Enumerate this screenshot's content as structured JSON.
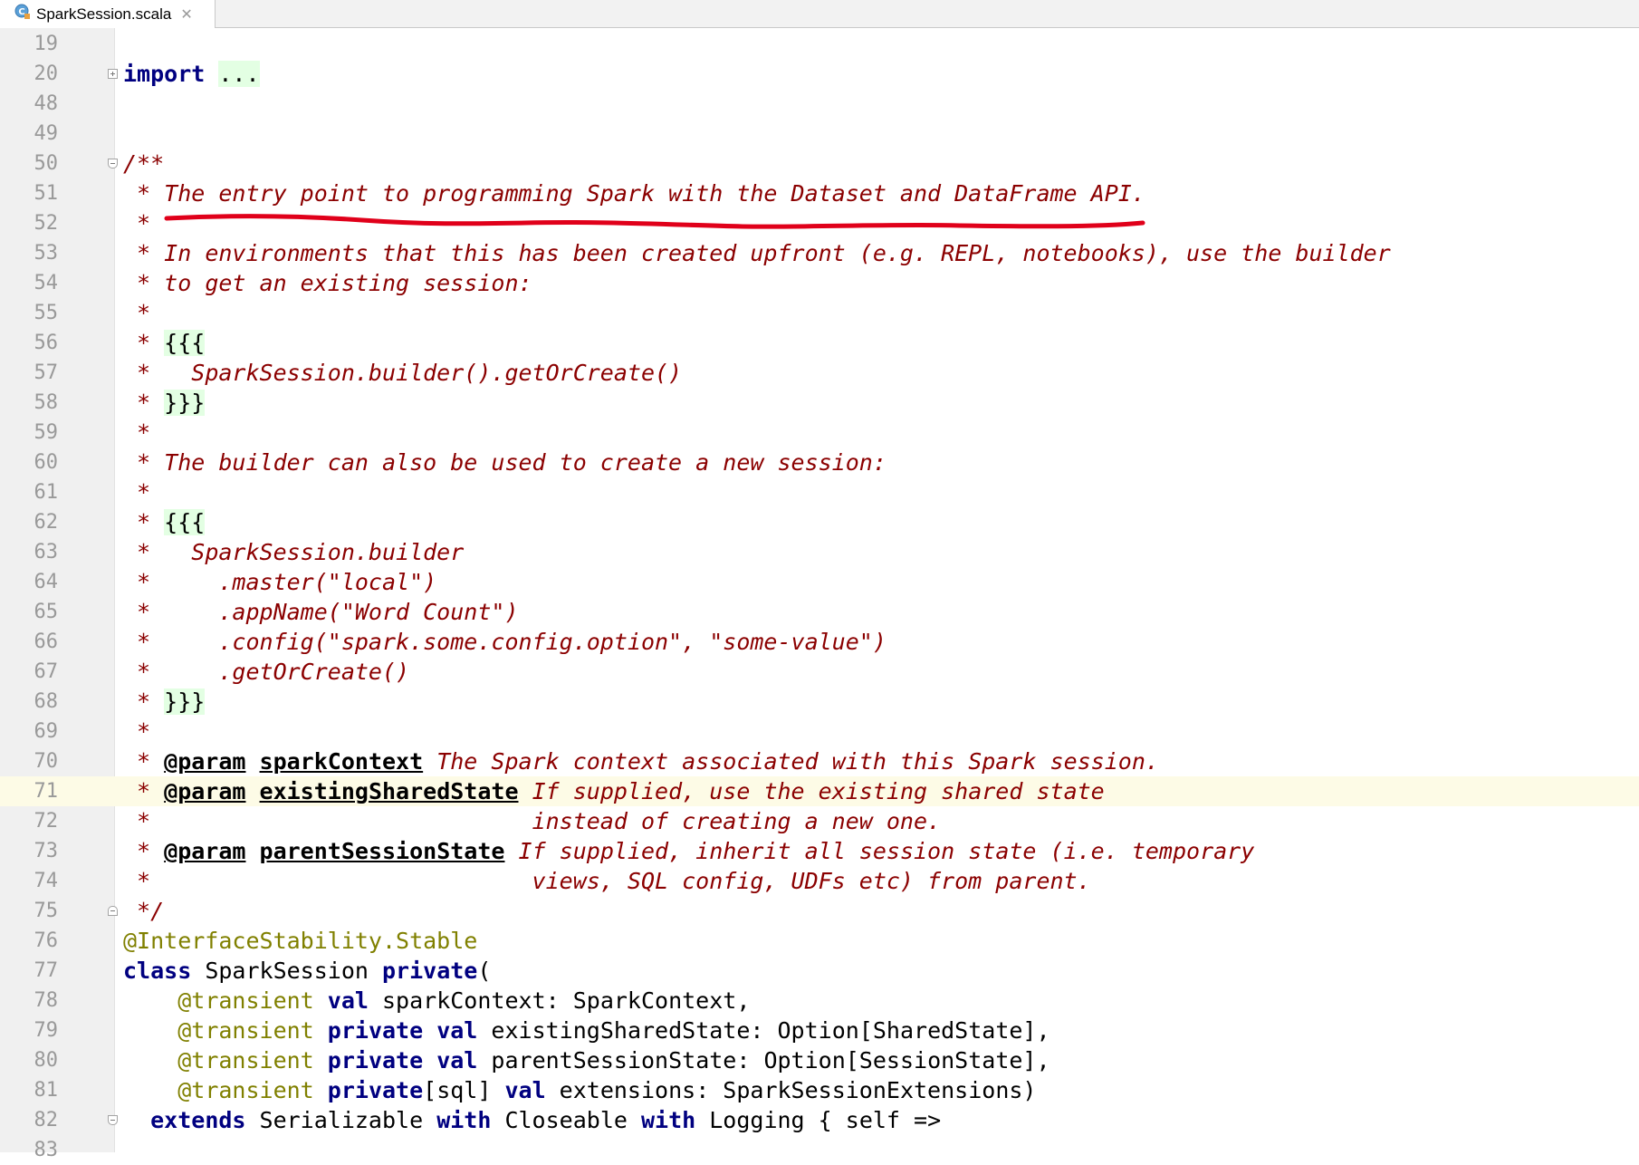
{
  "tab": {
    "filename": "SparkSession.scala",
    "file_icon": "scala-class-icon",
    "close_icon": "close-icon"
  },
  "colors": {
    "comment": "#8b0000",
    "keyword": "#000080",
    "annotation": "#808000",
    "current_line": "#fdfbe6",
    "gutter": "#f0f0f0",
    "markup_highlight": "#e3ffe3",
    "underline_ink": "#e0001a"
  },
  "lines": [
    {
      "num": "19",
      "fold": null,
      "segs": []
    },
    {
      "num": "20",
      "fold": "plus",
      "segs": [
        {
          "c": "kw",
          "t": "import"
        },
        {
          "c": "",
          "t": " "
        },
        {
          "c": "dots",
          "t": "..."
        }
      ]
    },
    {
      "num": "48",
      "fold": null,
      "segs": []
    },
    {
      "num": "49",
      "fold": null,
      "segs": []
    },
    {
      "num": "50",
      "fold": "minus",
      "segs": [
        {
          "c": "doc",
          "t": "/**"
        }
      ]
    },
    {
      "num": "51",
      "fold": null,
      "segs": [
        {
          "c": "ast",
          "t": " *"
        },
        {
          "c": "doc",
          "t": " The entry point to programming Spark with the Dataset and DataFrame API."
        }
      ]
    },
    {
      "num": "52",
      "fold": null,
      "segs": [
        {
          "c": "ast",
          "t": " *"
        }
      ]
    },
    {
      "num": "53",
      "fold": null,
      "segs": [
        {
          "c": "ast",
          "t": " *"
        },
        {
          "c": "doc",
          "t": " In environments that this has been created upfront (e.g. REPL, notebooks), use the builder"
        }
      ]
    },
    {
      "num": "54",
      "fold": null,
      "segs": [
        {
          "c": "ast",
          "t": " *"
        },
        {
          "c": "doc",
          "t": " to get an existing session:"
        }
      ]
    },
    {
      "num": "55",
      "fold": null,
      "segs": [
        {
          "c": "ast",
          "t": " *"
        }
      ]
    },
    {
      "num": "56",
      "fold": null,
      "segs": [
        {
          "c": "ast",
          "t": " * "
        },
        {
          "c": "fence",
          "t": "{{{"
        }
      ]
    },
    {
      "num": "57",
      "fold": null,
      "segs": [
        {
          "c": "ast",
          "t": " *"
        },
        {
          "c": "doc",
          "t": "   SparkSession.builder().getOrCreate()"
        }
      ]
    },
    {
      "num": "58",
      "fold": null,
      "segs": [
        {
          "c": "ast",
          "t": " * "
        },
        {
          "c": "fence",
          "t": "}}}"
        }
      ]
    },
    {
      "num": "59",
      "fold": null,
      "segs": [
        {
          "c": "ast",
          "t": " *"
        }
      ]
    },
    {
      "num": "60",
      "fold": null,
      "segs": [
        {
          "c": "ast",
          "t": " *"
        },
        {
          "c": "doc",
          "t": " The builder can also be used to create a new session:"
        }
      ]
    },
    {
      "num": "61",
      "fold": null,
      "segs": [
        {
          "c": "ast",
          "t": " *"
        }
      ]
    },
    {
      "num": "62",
      "fold": null,
      "segs": [
        {
          "c": "ast",
          "t": " * "
        },
        {
          "c": "fence",
          "t": "{{{"
        }
      ]
    },
    {
      "num": "63",
      "fold": null,
      "segs": [
        {
          "c": "ast",
          "t": " *"
        },
        {
          "c": "doc",
          "t": "   SparkSession.builder"
        }
      ]
    },
    {
      "num": "64",
      "fold": null,
      "segs": [
        {
          "c": "ast",
          "t": " *"
        },
        {
          "c": "doc",
          "t": "     .master(\"local\")"
        }
      ]
    },
    {
      "num": "65",
      "fold": null,
      "segs": [
        {
          "c": "ast",
          "t": " *"
        },
        {
          "c": "doc",
          "t": "     .appName(\"Word Count\")"
        }
      ]
    },
    {
      "num": "66",
      "fold": null,
      "segs": [
        {
          "c": "ast",
          "t": " *"
        },
        {
          "c": "doc",
          "t": "     .config(\"spark.some.config.option\", \"some-value\")"
        }
      ]
    },
    {
      "num": "67",
      "fold": null,
      "segs": [
        {
          "c": "ast",
          "t": " *"
        },
        {
          "c": "doc",
          "t": "     .getOrCreate()"
        }
      ]
    },
    {
      "num": "68",
      "fold": null,
      "segs": [
        {
          "c": "ast",
          "t": " * "
        },
        {
          "c": "fence",
          "t": "}}}"
        }
      ]
    },
    {
      "num": "69",
      "fold": null,
      "segs": [
        {
          "c": "ast",
          "t": " *"
        }
      ]
    },
    {
      "num": "70",
      "fold": null,
      "segs": [
        {
          "c": "ast",
          "t": " * "
        },
        {
          "c": "tag",
          "t": "@param"
        },
        {
          "c": "doc",
          "t": " "
        },
        {
          "c": "param",
          "t": "sparkContext"
        },
        {
          "c": "doc",
          "t": " The Spark context associated with this Spark session."
        }
      ]
    },
    {
      "num": "71",
      "fold": null,
      "current": true,
      "segs": [
        {
          "c": "ast",
          "t": " * "
        },
        {
          "c": "tag",
          "t": "@param"
        },
        {
          "c": "doc",
          "t": " "
        },
        {
          "c": "param",
          "t": "existingSharedState"
        },
        {
          "c": "doc",
          "t": " If supplied, use the existing shared state"
        }
      ]
    },
    {
      "num": "72",
      "fold": null,
      "segs": [
        {
          "c": "ast",
          "t": " *"
        },
        {
          "c": "doc",
          "t": "                            instead of creating a new one."
        }
      ]
    },
    {
      "num": "73",
      "fold": null,
      "segs": [
        {
          "c": "ast",
          "t": " * "
        },
        {
          "c": "tag",
          "t": "@param"
        },
        {
          "c": "doc",
          "t": " "
        },
        {
          "c": "param",
          "t": "parentSessionState"
        },
        {
          "c": "doc",
          "t": " If supplied, inherit all session state (i.e. temporary"
        }
      ]
    },
    {
      "num": "74",
      "fold": null,
      "segs": [
        {
          "c": "ast",
          "t": " *"
        },
        {
          "c": "doc",
          "t": "                            views, SQL config, UDFs etc) from parent."
        }
      ]
    },
    {
      "num": "75",
      "fold": "end",
      "segs": [
        {
          "c": "doc",
          "t": " */"
        }
      ]
    },
    {
      "num": "76",
      "fold": null,
      "segs": [
        {
          "c": "anno",
          "t": "@InterfaceStability.Stable"
        }
      ]
    },
    {
      "num": "77",
      "fold": null,
      "segs": [
        {
          "c": "kw",
          "t": "class"
        },
        {
          "c": "",
          "t": " SparkSession "
        },
        {
          "c": "kw",
          "t": "private"
        },
        {
          "c": "",
          "t": "("
        }
      ]
    },
    {
      "num": "78",
      "fold": null,
      "segs": [
        {
          "c": "",
          "t": "    "
        },
        {
          "c": "anno",
          "t": "@transient"
        },
        {
          "c": "",
          "t": " "
        },
        {
          "c": "kw",
          "t": "val"
        },
        {
          "c": "",
          "t": " sparkContext: SparkContext,"
        }
      ]
    },
    {
      "num": "79",
      "fold": null,
      "segs": [
        {
          "c": "",
          "t": "    "
        },
        {
          "c": "anno",
          "t": "@transient"
        },
        {
          "c": "",
          "t": " "
        },
        {
          "c": "kw",
          "t": "private val"
        },
        {
          "c": "",
          "t": " existingSharedState: Option[SharedState],"
        }
      ]
    },
    {
      "num": "80",
      "fold": null,
      "segs": [
        {
          "c": "",
          "t": "    "
        },
        {
          "c": "anno",
          "t": "@transient"
        },
        {
          "c": "",
          "t": " "
        },
        {
          "c": "kw",
          "t": "private val"
        },
        {
          "c": "",
          "t": " parentSessionState: Option[SessionState],"
        }
      ]
    },
    {
      "num": "81",
      "fold": null,
      "segs": [
        {
          "c": "",
          "t": "    "
        },
        {
          "c": "anno",
          "t": "@transient"
        },
        {
          "c": "",
          "t": " "
        },
        {
          "c": "kw",
          "t": "private"
        },
        {
          "c": "",
          "t": "[sql] "
        },
        {
          "c": "kw",
          "t": "val"
        },
        {
          "c": "",
          "t": " extensions: SparkSessionExtensions)"
        }
      ]
    },
    {
      "num": "82",
      "fold": "minus",
      "segs": [
        {
          "c": "",
          "t": "  "
        },
        {
          "c": "kw",
          "t": "extends"
        },
        {
          "c": "",
          "t": " Serializable "
        },
        {
          "c": "kw",
          "t": "with"
        },
        {
          "c": "",
          "t": " Closeable "
        },
        {
          "c": "kw",
          "t": "with"
        },
        {
          "c": "",
          "t": " Logging { self =>"
        }
      ]
    },
    {
      "num": "83",
      "fold": null,
      "segs": []
    }
  ]
}
